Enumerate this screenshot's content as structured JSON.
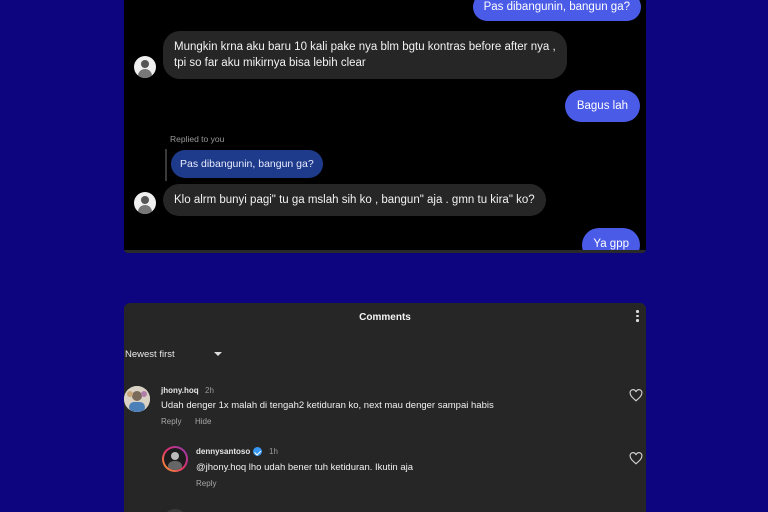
{
  "chat": {
    "messages": [
      {
        "side": "out",
        "text": "Pas dibangunin, bangun ga?"
      },
      {
        "side": "in",
        "line1": "Mungkin krna aku baru 10 kali pake nya blm bgtu kontras before after nya ,",
        "line2": "tpi so far aku mikirnya bisa lebih clear"
      },
      {
        "side": "out",
        "text": "Bagus lah"
      },
      {
        "side": "in",
        "replied_label": "Replied to you",
        "reply_quote": "Pas dibangunin, bangun ga?",
        "text": "Klo alrm bunyi pagi\" tu ga mslah sih ko , bangun\" aja . gmn tu kira\" ko?"
      },
      {
        "side": "out",
        "text": "Ya gpp"
      }
    ],
    "colors": {
      "outgoing": "#4a5be8",
      "incoming": "#262626",
      "reply_quote": "#1e3a8a"
    }
  },
  "comments": {
    "title": "Comments",
    "sort_label": "Newest first",
    "items": [
      {
        "username": "jhony.hoq",
        "time": "2h",
        "text": "Udah denger 1x malah di tengah2 ketiduran ko, next mau denger sampai habis",
        "actions": [
          "Reply",
          "Hide"
        ]
      },
      {
        "username": "dennysantoso",
        "verified": true,
        "time": "1h",
        "text": "@jhony.hoq lho udah bener tuh ketiduran. Ikutin aja",
        "actions": [
          "Reply"
        ]
      }
    ],
    "icons": {
      "more": "more-vertical-icon",
      "sort": "chevron-down-icon",
      "like": "heart-icon",
      "verified": "verified-badge-icon"
    }
  }
}
